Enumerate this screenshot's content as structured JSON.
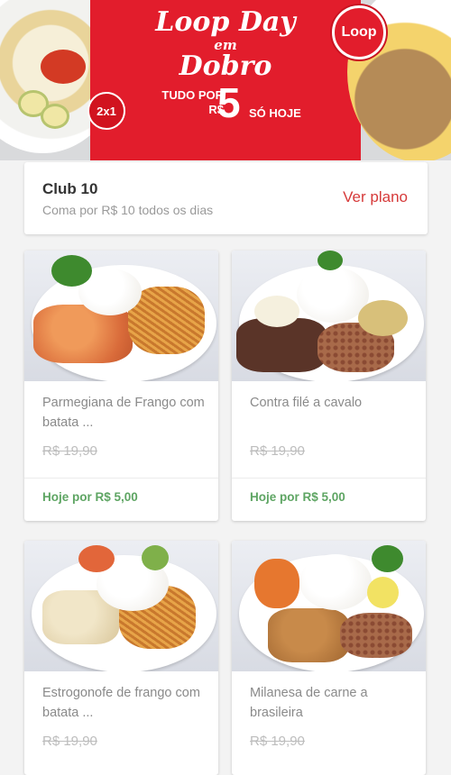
{
  "banner": {
    "title_line1": "Loop Day",
    "title_line2": "em",
    "title_line3": "Dobro",
    "promo_prefix": "TUDO POR R$",
    "promo_value": "5",
    "promo_suffix": "SÓ HOJE",
    "badge": "2x1",
    "logo": "Loop",
    "colors": {
      "brand_red": "#e21d2c"
    }
  },
  "club": {
    "title": "Club 10",
    "subtitle": "Coma por R$ 10 todos os dias",
    "action": "Ver plano"
  },
  "products": [
    {
      "name": "Parmegiana de Frango com batata ...",
      "old_price": "R$ 19,90",
      "today": "Hoje por R$ 5,00"
    },
    {
      "name": "Contra filé a cavalo",
      "old_price": "R$ 19,90",
      "today": "Hoje por R$ 5,00"
    },
    {
      "name": "Estrogonofe de frango com batata ...",
      "old_price": "R$ 19,90"
    },
    {
      "name": "Milanesa de carne a brasileira",
      "old_price": "R$ 19,90"
    }
  ]
}
